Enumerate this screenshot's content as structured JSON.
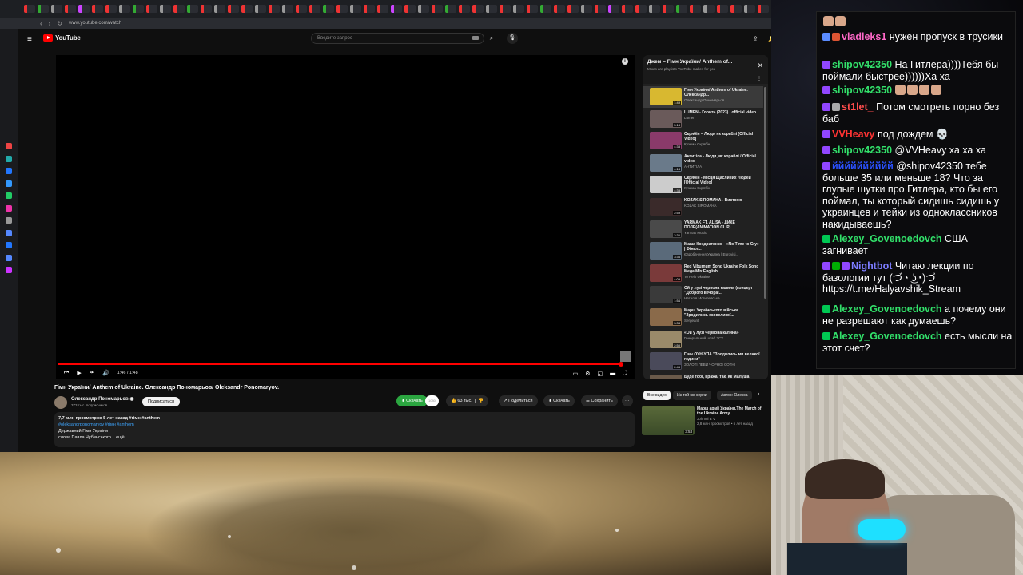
{
  "browser": {
    "url": "www.youtube.com/watch",
    "tab_colors": [
      "#e33",
      "#3a3",
      "#999",
      "#e33",
      "#c4f",
      "#e33",
      "#e33",
      "#999",
      "#3a3",
      "#e33",
      "#999",
      "#e33",
      "#3a3",
      "#e33",
      "#999",
      "#e33",
      "#e33",
      "#999",
      "#e33",
      "#999",
      "#e33",
      "#e33",
      "#3a3",
      "#e33",
      "#999",
      "#e33",
      "#e33",
      "#c4f",
      "#e33",
      "#999",
      "#e33",
      "#3a3",
      "#e33",
      "#e33",
      "#999",
      "#e33",
      "#999",
      "#e33",
      "#3a3",
      "#e33",
      "#e33",
      "#999",
      "#e33",
      "#c4f",
      "#e33",
      "#e33",
      "#999",
      "#e33",
      "#3a3",
      "#e33",
      "#999",
      "#e33",
      "#e33",
      "#999",
      "#e33",
      "#f3c"
    ],
    "sidebar_icon_colors": [
      "#e44",
      "#2aa",
      "#27f",
      "#39f",
      "#2c6",
      "#e3a",
      "#999",
      "#58f",
      "#27f",
      "#58f",
      "#c3f"
    ]
  },
  "youtube": {
    "logo_text": "YouTube",
    "search_placeholder": "Введите запрос",
    "video": {
      "title": "Гімн України/ Anthem of Ukraine. Олександр Пономарьов/ Oleksandr Ponomaryov.",
      "time": "1:46 / 1:48",
      "progress": 0.98
    },
    "channel": {
      "name": "Олександр Пономарьов ◉",
      "subscribers": "373 тыс. подписчиков",
      "subscribe_label": "Подписаться"
    },
    "actions": {
      "download_green": "Скачать",
      "download_count": "1080",
      "likes": "63 тыс.",
      "share": "Поделиться",
      "download": "Скачать",
      "save": "Сохранить",
      "more": "···"
    },
    "description": {
      "meta": "7,7 млн просмотров  5 лет назад  #гімн #anthem",
      "tags": "#oleksandrponomaryov #гімн #anthem",
      "line1": "Державний Гімн України  ",
      "line2": "слова Павла Чубинського ...ещё"
    },
    "playlist": {
      "title": "Джем – Гімн України/ Anthem of...",
      "subtitle": "Mixes are playlists YouTube makes for you",
      "items": [
        {
          "title": "Гімн України/ Anthem of Ukraine. Олександр...",
          "author": "Олександр Пономарьов",
          "duration": "1:49",
          "color": "#d8b830",
          "active": true
        },
        {
          "title": "LUMEN - Горить (2023) | official video",
          "author": "Lumen",
          "duration": "5:18",
          "color": "#6a5a5a"
        },
        {
          "title": "Скрябін – Люди як кораблі [Official Video]",
          "author": "Кузьма Скрябін",
          "duration": "4:38",
          "color": "#8a3a6a"
        },
        {
          "title": "Антитіла - Люди, як кораблі / Official video",
          "author": "АНТИТІЛА",
          "duration": "4:18",
          "color": "#6a7a8a"
        },
        {
          "title": "Скрябін - Місця Щасливих Людей [Official Video]",
          "author": "Кузьма Скрябін",
          "duration": "4:33",
          "color": "#ccc"
        },
        {
          "title": "KOZAK SIROMAHA - Вистояю",
          "author": "KOZAK SIROMAHA",
          "duration": "2:59",
          "color": "#3a2a2a"
        },
        {
          "title": "YARMAK FT. ALISA - ДИКЕ ПОЛЕ(ANIMATION CLIP)",
          "author": "Yarmak Music",
          "duration": "3:36",
          "color": "#4a4a4a"
        },
        {
          "title": "Маша Кондратенко – «No Time to Cry» | Фінал...",
          "author": "Євробачення Україна | Eurovisi...",
          "duration": "3:36",
          "color": "#5a6a7a"
        },
        {
          "title": "Red Viburnum Song Ukraine Folk Song Mega Mix English...",
          "author": "To Help Ukraine",
          "duration": "4:09",
          "color": "#7a3a3a"
        },
        {
          "title": "Ой у лузі червона калина (концерт \"Доброго вечора!...",
          "author": "Наталія Могилевська",
          "duration": "1:54",
          "color": "#3a3a3a"
        },
        {
          "title": "Марш Українського війська \"Зродились ми великої...",
          "author": "Sergeant",
          "duration": "3:33",
          "color": "#8a6a4a"
        },
        {
          "title": "«Ой у лузі червона калина»",
          "author": "Генеральний штаб ЗСУ",
          "duration": "2:50",
          "color": "#9a8a6a"
        },
        {
          "title": "Гімн ОУН-УПА \"Зродились ми великої години\"",
          "author": "ЗОЛОТІ ЛЕВИ ЧОРНОЇ СОТНІ",
          "duration": "2:45",
          "color": "#4a4a5a"
        },
        {
          "title": "Буде тобі, вража, так, як Малуша казала",
          "author": "",
          "duration": "",
          "color": "#6a5a4a"
        }
      ]
    },
    "chips": [
      "Все видео",
      "Из той же серии",
      "Автор: Олекса"
    ],
    "recommendation": {
      "title": "Марш армії України.The March of the Ukraine Army",
      "channel": "Johnmi E V",
      "meta": "2,8 млн просмотров • 5 лет назад",
      "duration": "3:53"
    }
  },
  "chat": {
    "messages": [
      {
        "user": "vladleks1",
        "color": "#ff69c8",
        "text": " нужен пропуск в трусики",
        "badges": [
          "#5b8cff",
          "#d53"
        ]
      },
      {
        "user": "shipov42350",
        "color": "#32e06a",
        "text": " На Гитлера))))Тебя бы поймали быстрее))))))Ха ха",
        "badges": [
          "#9146ff"
        ]
      },
      {
        "user": "shipov42350",
        "color": "#32e06a",
        "text": " ",
        "badges": [
          "#9146ff"
        ],
        "emotes": 4
      },
      {
        "user": "st1let_",
        "color": "#ff4d4d",
        "text": " Потом смотреть порно без баб",
        "badges": [
          "#9146ff",
          "#aaa"
        ]
      },
      {
        "user": "VVHeavy",
        "color": "#ff3333",
        "text": " под дождем 💀",
        "badges": [
          "#9146ff"
        ]
      },
      {
        "user": "shipov42350",
        "color": "#32e06a",
        "text": " @VVHeavy ха ха ха",
        "badges": [
          "#9146ff"
        ]
      },
      {
        "user": "йййййййййй",
        "color": "#2b52ff",
        "text": " @shipov42350 тебе больше 35 или меньше 18? Что за глупые шутки про Гитлера, кто бы его поймал, ты который сидишь сидишь у украинцев и тейки из одноклассников накидываешь?",
        "badges": [
          "#9146ff"
        ]
      },
      {
        "user": "Alexey_Govenoedovch",
        "color": "#32e06a",
        "text": " США загнивает",
        "badges": [
          "#00c853"
        ]
      },
      {
        "user": "Nightbot",
        "color": "#7c7cff",
        "text": " Читаю лекции по базологии тут (づ◔ ͜ʖ◔)づ https://t.me/Halyavshik_Stream",
        "badges": [
          "#9146ff",
          "#00ad03",
          "#9146ff"
        ]
      },
      {
        "user": "Alexey_Govenoedovch",
        "color": "#32e06a",
        "text": " а почему они не разрешают как думаешь?",
        "badges": [
          "#00c853"
        ]
      },
      {
        "user": "Alexey_Govenoedovch",
        "color": "#32e06a",
        "text": " есть мысли на этот счет?",
        "badges": [
          "#00c853"
        ]
      }
    ]
  }
}
